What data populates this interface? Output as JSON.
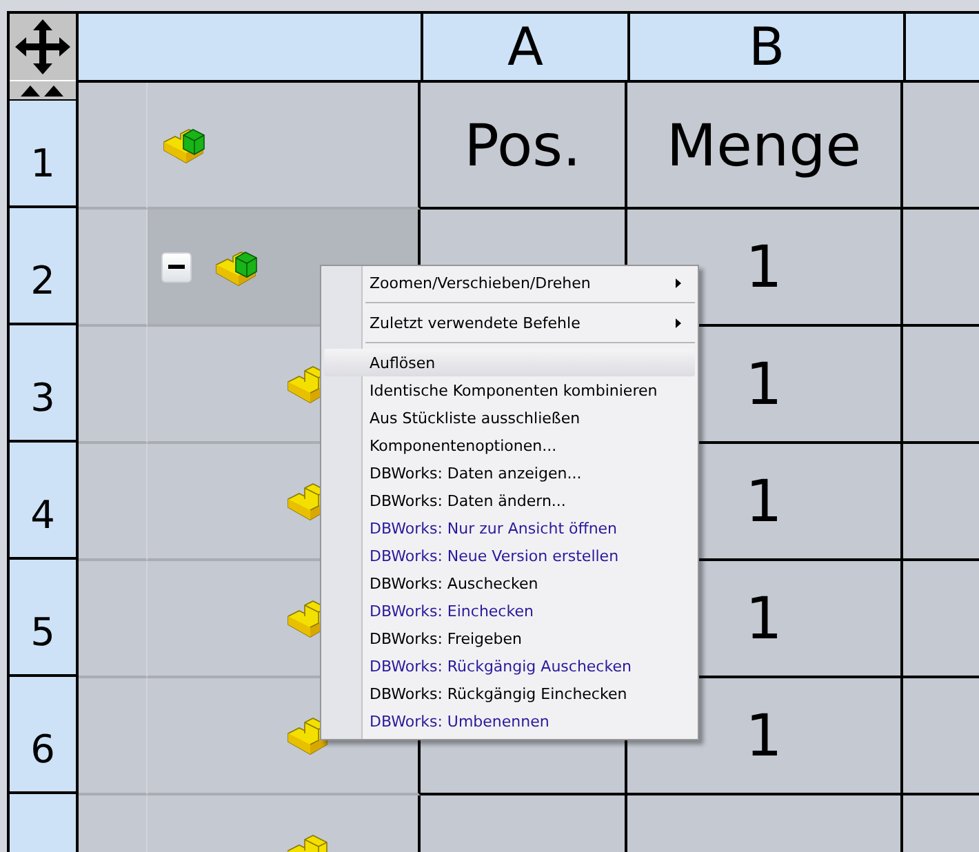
{
  "columns": [
    {
      "label": "A"
    },
    {
      "label": "B"
    }
  ],
  "rows": [
    {
      "number": "1",
      "kind": "assembly",
      "pos": "Pos.",
      "menge": "Menge",
      "selected": false
    },
    {
      "number": "2",
      "kind": "assembly",
      "menge": "1",
      "selected": true,
      "expanded": true,
      "children": [
        {
          "number": "3",
          "kind": "part",
          "menge": "1",
          "selected": false
        },
        {
          "number": "4",
          "kind": "part",
          "menge": "1",
          "selected": false
        },
        {
          "number": "5",
          "kind": "part",
          "menge": "1",
          "selected": false
        },
        {
          "number": "6",
          "kind": "part",
          "menge": "1",
          "selected": false
        },
        {
          "kind": "part",
          "selected": false
        }
      ]
    }
  ],
  "context_menu": {
    "items": [
      {
        "label": "Zoomen/Verschieben/Drehen",
        "submenu": true,
        "separator_after": true,
        "selected": false,
        "color": "#000000"
      },
      {
        "label": "Zuletzt verwendete Befehle",
        "submenu": true,
        "separator_after": true,
        "selected": false,
        "color": "#000000"
      },
      {
        "label": "Auflösen",
        "selected": true,
        "color": "#000000"
      },
      {
        "label": "Identische Komponenten kombinieren",
        "selected": false,
        "color": "#000000"
      },
      {
        "label": "Aus Stückliste ausschließen",
        "selected": false,
        "color": "#000000"
      },
      {
        "label": "Komponentenoptionen...",
        "selected": false,
        "color": "#000000"
      },
      {
        "label": "DBWorks: Daten anzeigen...",
        "selected": false,
        "color": "#000000"
      },
      {
        "label": "DBWorks: Daten ändern...",
        "selected": false,
        "color": "#000000"
      },
      {
        "label": "DBWorks: Nur zur Ansicht öffnen",
        "selected": false,
        "color": "#2a1a9a"
      },
      {
        "label": "DBWorks: Neue Version erstellen",
        "selected": false,
        "color": "#2a1a9a"
      },
      {
        "label": "DBWorks: Auschecken",
        "selected": false,
        "color": "#000000"
      },
      {
        "label": "DBWorks: Einchecken",
        "selected": false,
        "color": "#2a1a9a"
      },
      {
        "label": "DBWorks: Freigeben",
        "selected": false,
        "color": "#000000"
      },
      {
        "label": "DBWorks: Rückgängig Auschecken",
        "selected": false,
        "color": "#2a1a9a"
      },
      {
        "label": "DBWorks: Rückgängig Einchecken",
        "selected": false,
        "color": "#000000"
      },
      {
        "label": "DBWorks: Umbenennen",
        "selected": false,
        "color": "#2a1a9a"
      }
    ]
  }
}
